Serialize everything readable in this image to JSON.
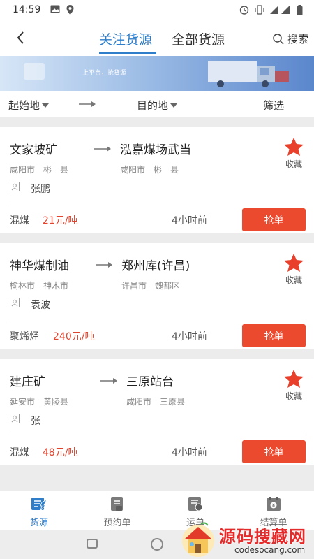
{
  "status_bar": {
    "time": "14:59",
    "left_icons": [
      "image-icon",
      "location-icon"
    ],
    "right_icons": [
      "alarm-icon",
      "vibrate-icon",
      "signal-icon",
      "battery-icon"
    ]
  },
  "header": {
    "tabs": [
      {
        "label": "关注货源",
        "active": true
      },
      {
        "label": "全部货源",
        "active": false
      }
    ],
    "search_label": "搜索"
  },
  "banner": {
    "slogan": "上平台，抢货源"
  },
  "filter": {
    "origin_label": "起始地",
    "destination_label": "目的地",
    "filter_label": "筛选"
  },
  "listings": [
    {
      "origin": "文家坡矿",
      "destination": "泓嘉煤场武当",
      "origin_region": "咸阳市 - 彬　县",
      "destination_region": "咸阳市 - 彬　县",
      "contact": "张鹏",
      "favorite_label": "收藏",
      "cargo": "混煤",
      "price": "21元/吨",
      "posted": "4小时前",
      "action_label": "抢单"
    },
    {
      "origin": "神华煤制油",
      "destination": "郑州库(许昌)",
      "origin_region": "榆林市 - 神木市",
      "destination_region": "许昌市 - 魏都区",
      "contact": "袁波",
      "favorite_label": "收藏",
      "cargo": "聚烯烃",
      "price": "240元/吨",
      "posted": "4小时前",
      "action_label": "抢单"
    },
    {
      "origin": "建庄矿",
      "destination": "三原站台",
      "origin_region": "延安市 - 黄陵县",
      "destination_region": "咸阳市 - 三原县",
      "contact": "张",
      "favorite_label": "收藏",
      "cargo": "混煤",
      "price": "48元/吨",
      "posted": "4小时前",
      "action_label": "抢单"
    }
  ],
  "bottom_nav": [
    {
      "label": "货源",
      "icon": "cargo-icon",
      "active": true
    },
    {
      "label": "预约单",
      "icon": "booking-icon",
      "active": false
    },
    {
      "label": "运单",
      "icon": "waybill-icon",
      "active": false
    },
    {
      "label": "结算单",
      "icon": "settlement-icon",
      "active": false
    }
  ],
  "watermark": {
    "title": "源码搜藏网",
    "url": "codesocang.com"
  },
  "colors": {
    "accent": "#2f7ec9",
    "action": "#ec4a2f",
    "price": "#e2452e",
    "favorite": "#e8402b"
  }
}
